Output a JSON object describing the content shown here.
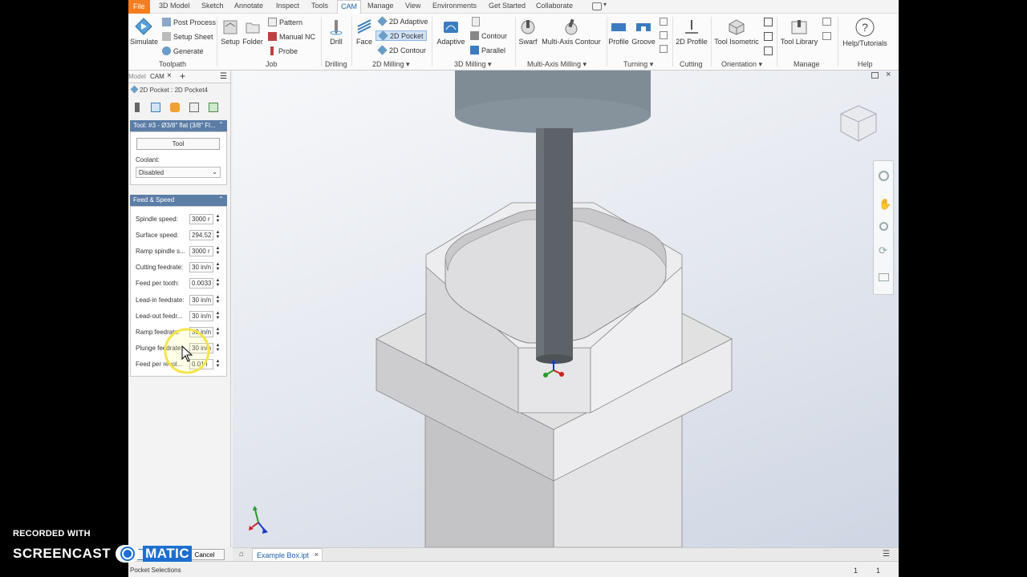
{
  "menu": {
    "tabs": [
      "File",
      "3D Model",
      "Sketch",
      "Annotate",
      "Inspect",
      "Tools",
      "CAM",
      "Manage",
      "View",
      "Environments",
      "Get Started",
      "Collaborate"
    ],
    "active_tab": "CAM"
  },
  "ribbon": {
    "toolpath": {
      "simulate": "Simulate",
      "post_process": "Post Process",
      "setup_sheet": "Setup Sheet",
      "generate": "Generate",
      "group": "Toolpath"
    },
    "job": {
      "setup": "Setup",
      "folder": "Folder",
      "pattern": "Pattern",
      "manual_nc": "Manual NC",
      "probe": "Probe",
      "group": "Job"
    },
    "drilling": {
      "drill": "Drill",
      "group": "Drilling"
    },
    "milling2d": {
      "face": "Face",
      "adaptive": "2D Adaptive",
      "pocket": "2D Pocket",
      "contour": "2D Contour",
      "group": "2D Milling"
    },
    "milling3d": {
      "adaptive": "Adaptive",
      "contour": "Contour",
      "parallel": "Parallel",
      "group": "3D Milling"
    },
    "multi_axis": {
      "swarf": "Swarf",
      "multi_axis_contour": "Multi-Axis Contour",
      "group": "Multi-Axis Milling"
    },
    "turning": {
      "profile": "Profile",
      "groove": "Groove",
      "group": "Turning"
    },
    "cutting": {
      "profile2d": "2D Profile",
      "group": "Cutting"
    },
    "orientation": {
      "tool_isometric": "Tool Isometric",
      "group": "Orientation"
    },
    "manage": {
      "tool_library": "Tool Library",
      "group": "Manage"
    },
    "help": {
      "help_tutorials": "Help/Tutorials",
      "group": "Help"
    }
  },
  "panel": {
    "tabs": [
      "Model",
      "CAM"
    ],
    "breadcrumb": "2D Pocket : 2D Pocket4",
    "tool_section": {
      "header": "Tool: #3 - Ø3/8\" flat (3/8\" Fl...",
      "tool_button": "Tool",
      "coolant_label": "Coolant:",
      "coolant_value": "Disabled"
    },
    "feed_section": {
      "header": "Feed & Speed",
      "rows": [
        {
          "label": "Spindle speed:",
          "value": "3000 r"
        },
        {
          "label": "Surface speed:",
          "value": "294.52"
        },
        {
          "label": "Ramp spindle s...",
          "value": "3000 r"
        },
        {
          "label": "Cutting feedrate:",
          "value": "30 in/n"
        },
        {
          "label": "Feed per tooth:",
          "value": "0.0033"
        },
        {
          "label": "Lead-in feedrate:",
          "value": "30 in/n"
        },
        {
          "label": "Lead-out feedr...",
          "value": "30 in/n"
        },
        {
          "label": "Ramp feedrate:",
          "value": "30 in/n"
        },
        {
          "label": "Plunge feedrate:",
          "value": "30 in/n"
        },
        {
          "label": "Feed per revol...",
          "value": "0.01 i"
        }
      ]
    },
    "ok_label": "OK",
    "cancel_label": "Cancel",
    "status_hint": "Pocket Selections"
  },
  "document": {
    "tab": "Example Box.ipt"
  },
  "statusbar": {
    "count1": "1",
    "count2": "1"
  },
  "watermark": {
    "line1": "RECORDED WITH",
    "line2_a": "SCREENCAST",
    "line2_b": "MATIC"
  },
  "colors": {
    "file_tab": "#f57d1f",
    "panel_header": "#5b7da6",
    "accent": "#1b5fa8"
  }
}
